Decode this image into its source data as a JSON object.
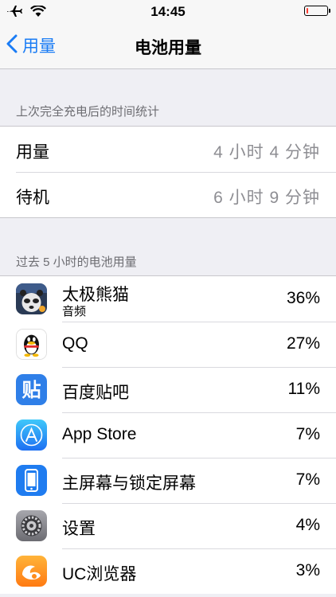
{
  "status_bar": {
    "time": "14:45",
    "battery_level_fraction": 0.08
  },
  "nav": {
    "back_label": "用量",
    "title": "电池用量"
  },
  "since_charge": {
    "header": "上次完全充电后的时间统计",
    "rows": [
      {
        "title": "用量",
        "value": "4 小时 4 分钟"
      },
      {
        "title": "待机",
        "value": "6 小时 9 分钟"
      }
    ]
  },
  "usage": {
    "header": "过去 5 小时的电池用量",
    "apps": [
      {
        "name": "太极熊猫",
        "sub": "音频",
        "percent": "36%",
        "icon": "taiji-panda-game-icon"
      },
      {
        "name": "QQ",
        "sub": "",
        "percent": "27%",
        "icon": "qq-penguin-icon"
      },
      {
        "name": "百度贴吧",
        "sub": "",
        "percent": "11%",
        "icon": "baidu-tieba-icon"
      },
      {
        "name": "App Store",
        "sub": "",
        "percent": "7%",
        "icon": "app-store-icon"
      },
      {
        "name": "主屏幕与锁定屏幕",
        "sub": "",
        "percent": "7%",
        "icon": "home-lock-screen-icon"
      },
      {
        "name": "设置",
        "sub": "",
        "percent": "4%",
        "icon": "settings-gear-icon"
      },
      {
        "name": "UC浏览器",
        "sub": "",
        "percent": "3%",
        "icon": "uc-browser-icon"
      }
    ]
  },
  "colors": {
    "accent": "#1a7cf5",
    "background": "#efeff4",
    "secondary_text": "#8e8e93"
  }
}
